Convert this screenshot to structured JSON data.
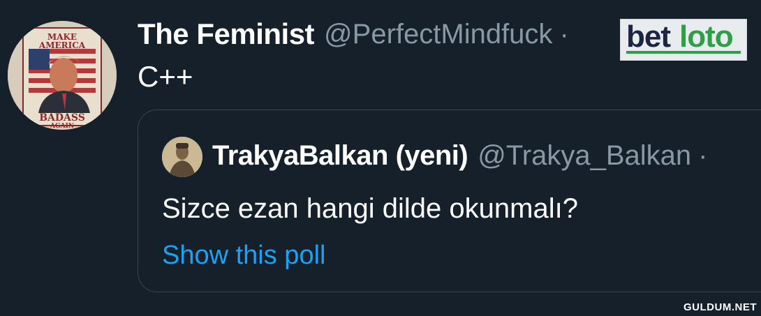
{
  "tweet": {
    "display_name": "The Feminist",
    "handle": "@PerfectMindfuck",
    "separator": "·",
    "text": "C++",
    "avatar_icon": "badass-poster-avatar",
    "avatar_poster_text": {
      "top_line_1": "MAKE",
      "top_line_2": "AMERICA",
      "bottom_line_1": "BADASS",
      "bottom_line_2": "AGAIN"
    }
  },
  "quoted_tweet": {
    "display_name": "TrakyaBalkan (yeni)",
    "handle": "@Trakya_Balkan",
    "separator": "·",
    "text": "Sizce ezan hangi dilde okunmalı?",
    "poll_link": "Show this poll",
    "avatar_icon": "portrait-avatar"
  },
  "ad": {
    "logo_part_1": "bet",
    "logo_part_2": "loto",
    "colors": {
      "dark": "#1c2541",
      "green": "#2e9e47",
      "background": "#e9ecef"
    }
  },
  "watermark": "GULDUM.NET",
  "colors": {
    "background": "#15202b",
    "text_primary": "#ffffff",
    "text_secondary": "#8899a6",
    "link": "#1da1f2",
    "border": "#38444d"
  }
}
